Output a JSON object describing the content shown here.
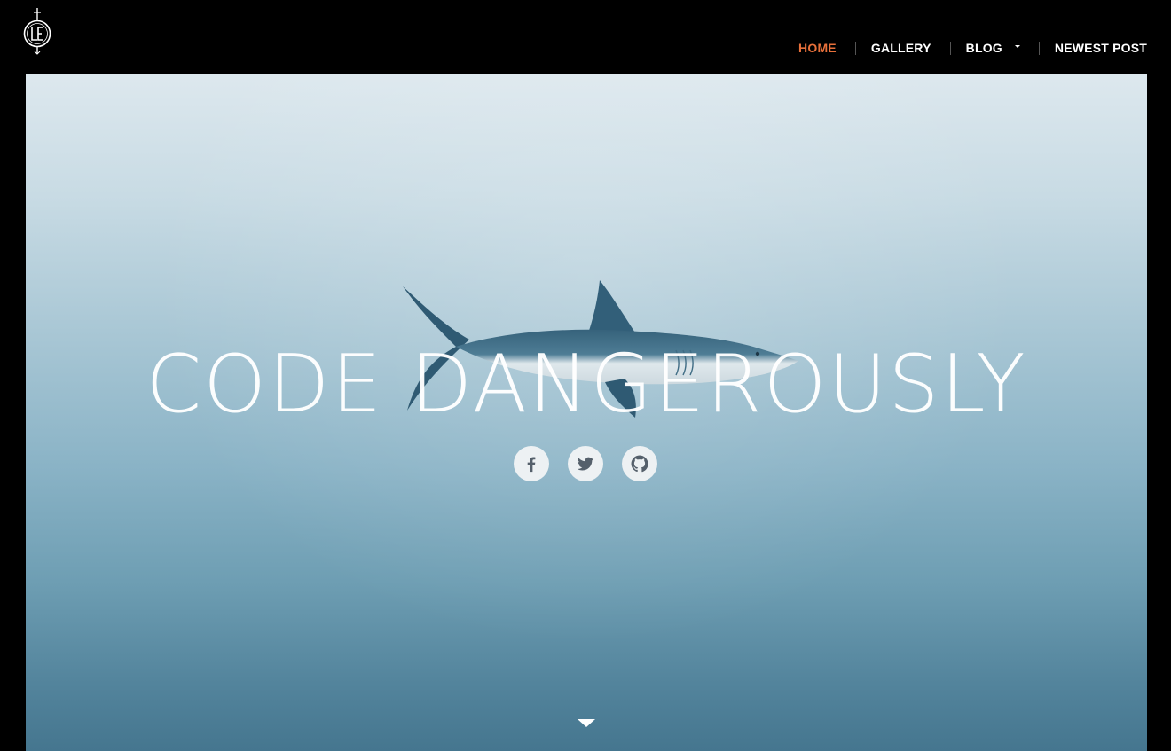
{
  "brand": {
    "logo_icon": "le-monogram-logo",
    "logo_text": "LE"
  },
  "nav": {
    "items": [
      {
        "label": "HOME",
        "active": true
      },
      {
        "label": "GALLERY",
        "active": false
      },
      {
        "label": "BLOG",
        "active": false,
        "dropdown": true
      },
      {
        "label": "NEWEST POST",
        "active": false
      }
    ],
    "active_color": "#e8703a"
  },
  "hero": {
    "title": "CODE DANGEROUSLY",
    "background_image": "shark-underwater-photo",
    "social_links": [
      {
        "icon": "facebook-icon"
      },
      {
        "icon": "twitter-icon"
      },
      {
        "icon": "github-icon"
      }
    ],
    "scroll_icon": "scroll-down-arrow-icon"
  }
}
